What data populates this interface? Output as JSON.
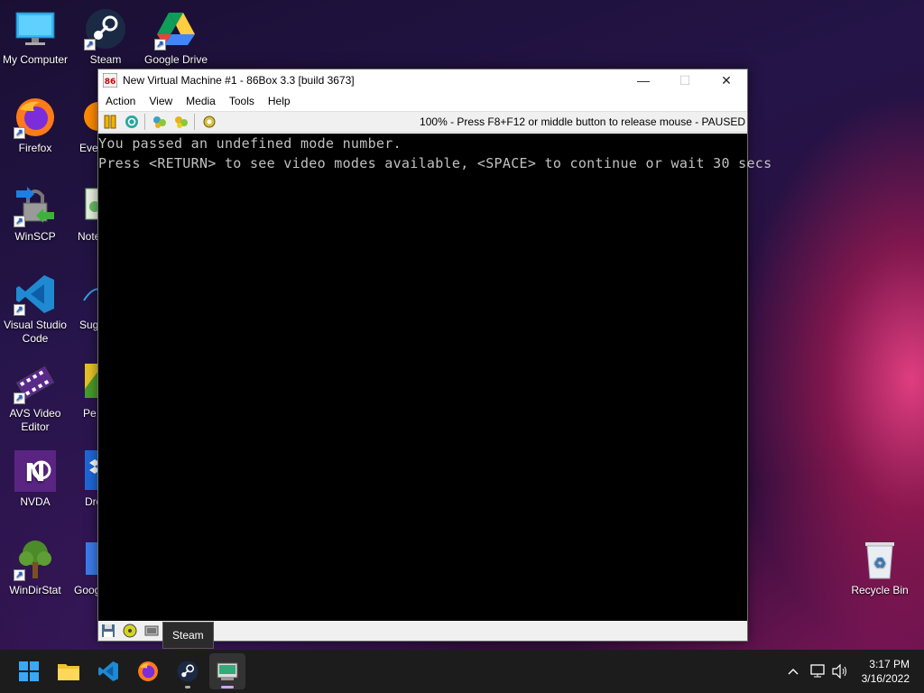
{
  "desktop": {
    "icons": [
      {
        "label": "My Computer"
      },
      {
        "label": "Steam"
      },
      {
        "label": "Google Drive"
      },
      {
        "label": "Firefox"
      },
      {
        "label": "Ever"
      },
      {
        "label": "WinSCP"
      },
      {
        "label": "Note"
      },
      {
        "label": "Visual Studio Code"
      },
      {
        "label": "Sug"
      },
      {
        "label": "AVS Video Editor"
      },
      {
        "label": "Pe"
      },
      {
        "label": "NVDA"
      },
      {
        "label": "Dro"
      },
      {
        "label": "WinDirStat"
      },
      {
        "label": "Goog"
      },
      {
        "label": "Recycle Bin"
      }
    ]
  },
  "window": {
    "title": "New Virtual Machine #1 - 86Box 3.3 [build 3673]",
    "menu": [
      "Action",
      "View",
      "Media",
      "Tools",
      "Help"
    ],
    "status_text": "100% - Press F8+F12 or middle button to release mouse - PAUSED",
    "screen_lines": [
      "You passed an undefined mode number.",
      "Press <RETURN> to see video modes available, <SPACE> to continue or wait 30 secs"
    ]
  },
  "tooltip": {
    "text": "Steam"
  },
  "taskbar": {
    "apps": [
      "start-icon",
      "file-explorer-icon",
      "vscode-icon",
      "firefox-icon",
      "steam-icon",
      "86box-icon"
    ],
    "clock": {
      "time": "3:17 PM",
      "date": "3/16/2022"
    }
  },
  "colors": {
    "accent": "#cfa3ff",
    "screen_text": "#c0c0c0"
  }
}
